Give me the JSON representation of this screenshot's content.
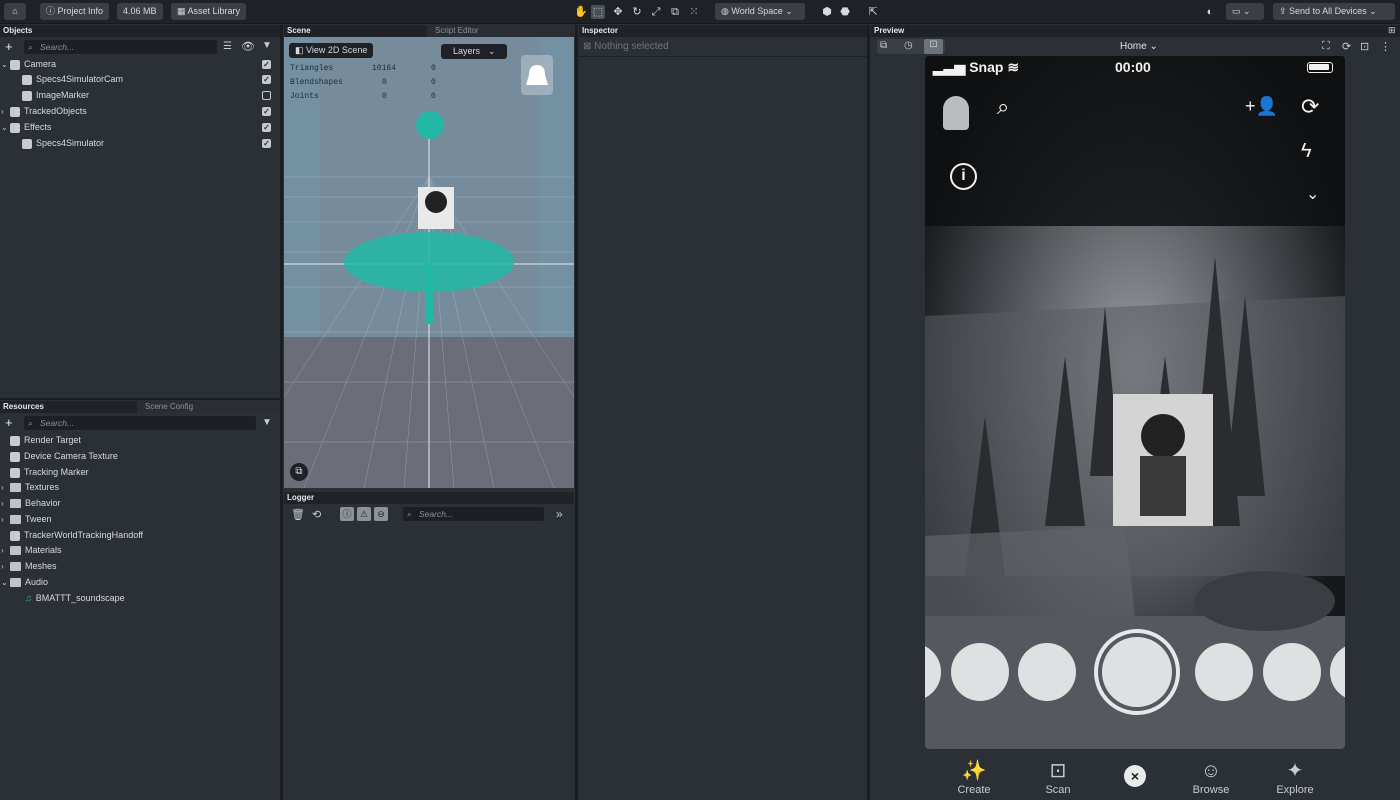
{
  "toolbar": {
    "project_info": "Project Info",
    "size": "4.06 MB",
    "asset_library": "Asset Library",
    "space": "World Space",
    "send": "Send to All Devices"
  },
  "objects": {
    "title": "Objects",
    "search_placeholder": "Search...",
    "items": [
      {
        "label": "Camera",
        "checked": true
      },
      {
        "label": "Specs4SimulatorCam",
        "checked": true
      },
      {
        "label": "ImageMarker",
        "checked": false
      },
      {
        "label": "TrackedObjects",
        "checked": true
      },
      {
        "label": "Effects",
        "checked": true
      },
      {
        "label": "Specs4Simulator",
        "checked": true
      }
    ]
  },
  "resources": {
    "title": "Resources",
    "tab2": "Scene Config",
    "search_placeholder": "Search...",
    "items": [
      "Render Target",
      "Device Camera Texture",
      "Tracking Marker",
      "Textures",
      "Behavior",
      "Tween",
      "TrackerWorldTrackingHandoff",
      "Materials",
      "Meshes",
      "Audio",
      "BMATTT_soundscape"
    ]
  },
  "scene": {
    "title": "Scene",
    "tab2": "Script Editor",
    "view2d": "View 2D Scene",
    "layers": "Layers",
    "stats": [
      {
        "name": "Triangles",
        "a": "10164",
        "b": "0"
      },
      {
        "name": "Blendshapes",
        "a": "0",
        "b": "0"
      },
      {
        "name": "Joints",
        "a": "0",
        "b": "0"
      }
    ]
  },
  "logger": {
    "title": "Logger",
    "search_placeholder": "Search..."
  },
  "inspector": {
    "title": "Inspector",
    "empty": "Nothing selected"
  },
  "preview": {
    "title": "Preview",
    "mode": "Home",
    "carrier": "Snap",
    "time": "00:00",
    "nav": [
      "Create",
      "Scan",
      "Browse",
      "Explore"
    ]
  },
  "colors": {
    "accent": "#22b8a5",
    "panel": "#2b3036",
    "toolbar": "#1e2227"
  }
}
